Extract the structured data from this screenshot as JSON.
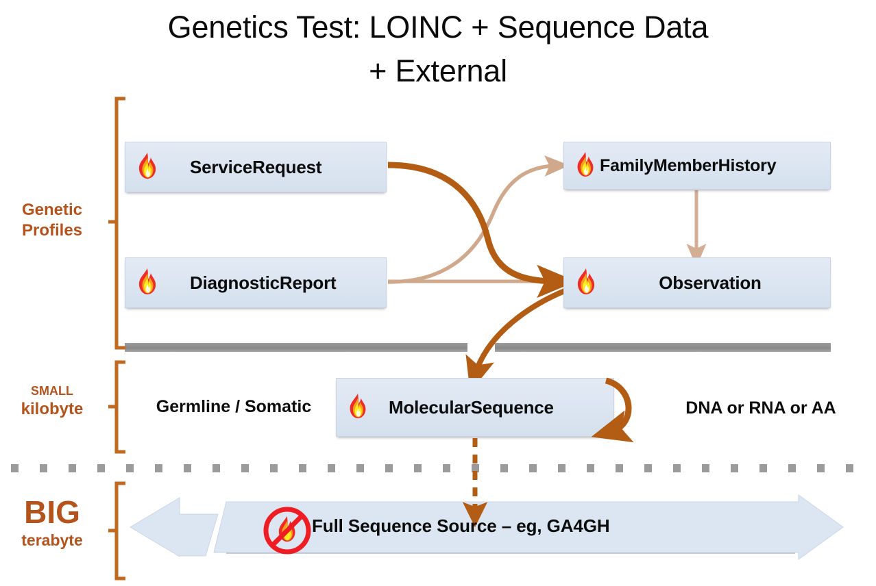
{
  "title": {
    "line1": "Genetics Test: LOINC + Sequence Data",
    "line2": "+ External"
  },
  "colors": {
    "accent_orange": "#B5531C",
    "brace_orange": "#C1691E",
    "arrow_dark": "#B35C13",
    "arrow_light": "#D0A98D",
    "box_fill": "#DCE5F1",
    "box_border": "#C8D4E4",
    "divider_gray": "#8C8C8C",
    "dotted_gray": "#9B9B9B",
    "band_fill": "#DCE6F2",
    "prohibition_red": "#EE1C23",
    "text_black": "#0D0D0D"
  },
  "sections": [
    {
      "id": "genetic-profiles",
      "label_line1": "Genetic",
      "label_line2": "Profiles"
    },
    {
      "id": "small-kilobyte",
      "label_line1": "SMALL",
      "label_line2": "kilobyte"
    },
    {
      "id": "big-terabyte",
      "label_line1": "BIG",
      "label_line2": "terabyte"
    }
  ],
  "resources": [
    {
      "id": "service-request",
      "label": "ServiceRequest",
      "icon": "fhir-flame-icon"
    },
    {
      "id": "diagnostic-report",
      "label": "DiagnosticReport",
      "icon": "fhir-flame-icon"
    },
    {
      "id": "family-history",
      "label": "FamilyMemberHistory",
      "icon": "fhir-flame-icon"
    },
    {
      "id": "observation",
      "label": "Observation",
      "icon": "fhir-flame-icon"
    },
    {
      "id": "molecular-sequence",
      "label": "MolecularSequence",
      "icon": "fhir-flame-icon"
    }
  ],
  "annotations": {
    "germline_somatic": "Germline / Somatic",
    "dna_rna_aa": "DNA or RNA or AA"
  },
  "bottom_band": {
    "label": "Full Sequence Source – eg, GA4GH",
    "icon": "no-fhir-prohibition-icon",
    "left_arrow": "left-arrow-shape",
    "right_arrow": "right-arrow-shape"
  },
  "connections": [
    {
      "from": "service-request",
      "to": "observation",
      "style": "thick-curve",
      "color": "#B35C13"
    },
    {
      "from": "diagnostic-report",
      "to": "family-history",
      "style": "thin-curve",
      "color": "#D0A98D"
    },
    {
      "from": "diagnostic-report",
      "to": "observation",
      "style": "thin-straight",
      "color": "#D0A98D"
    },
    {
      "from": "family-history",
      "to": "observation",
      "style": "thin-vertical",
      "color": "#D0A98D"
    },
    {
      "from": "observation",
      "to": "molecular-sequence",
      "style": "thick-curve",
      "color": "#B35C13"
    },
    {
      "from": "molecular-sequence",
      "to": "molecular-sequence",
      "style": "self-loop",
      "color": "#B35C13"
    },
    {
      "from": "molecular-sequence",
      "to": "bottom-band",
      "style": "dashed-vertical",
      "color": "#B35C13"
    }
  ]
}
